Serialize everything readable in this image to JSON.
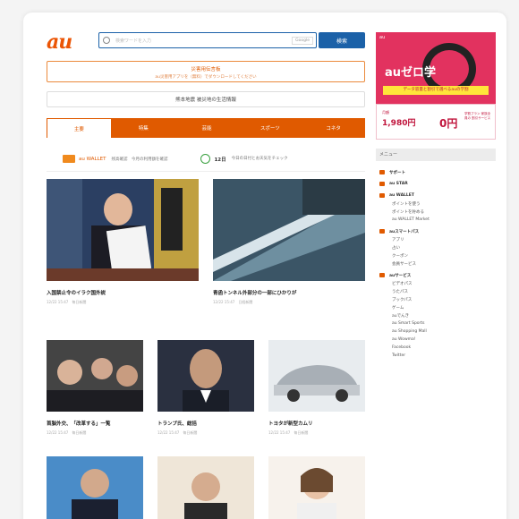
{
  "header": {
    "logo": "au",
    "search_placeholder": "検索ワードを入力",
    "search_engine": "Google",
    "search_button": "検索"
  },
  "notice": {
    "quake_title": "災害用伝言板",
    "quake_sub": "au災害用アプリを（無料）でダウンロードしてください",
    "kumamoto": "熊本地震 被災地の生活情報"
  },
  "tabs": [
    {
      "label": "主要"
    },
    {
      "label": "特集"
    },
    {
      "label": "芸能"
    },
    {
      "label": "スポーツ"
    },
    {
      "label": "コネタ"
    }
  ],
  "info": {
    "wallet_name": "au WALLET",
    "wallet_text": "残高確認　今月の利用額を確認",
    "date": "12日",
    "date_text": "今日の日付とお天気をチェック"
  },
  "news": {
    "big": [
      {
        "caption": "入国禁止令のイラク国外説　",
        "meta": "12/22 15:47　毎日新聞",
        "colors": [
          "#2b3f62",
          "#c0a040",
          "#e8e8e8",
          "#223"
        ]
      },
      {
        "caption": "青函トンネル外部分の一部にひかりが",
        "meta": "12/22 15:47　日経新聞",
        "colors": [
          "#3b5566",
          "#6e8fa0",
          "#d8e4ea",
          "#2b3b45"
        ]
      }
    ],
    "small": [
      {
        "caption": "首脳外交、「改革する」一覧",
        "meta": "12/22 15:47　毎日新聞",
        "colors": [
          "#2a2a2a",
          "#888",
          "#ddd"
        ]
      },
      {
        "caption": "トランプ氏、総括",
        "meta": "12/22 15:47　毎日新聞",
        "colors": [
          "#2a3040",
          "#c49a7c",
          "#fff"
        ]
      },
      {
        "caption": "トヨタが新型カムリ",
        "meta": "12/22 15:47　毎日新聞",
        "colors": [
          "#d8dde2",
          "#a8afb6",
          "#fff"
        ]
      }
    ]
  },
  "ad": {
    "corner": "au",
    "title": "auゼロ学",
    "band": "データ容量と割引で選べるauの学割",
    "bottom_label": "月額",
    "price": "1,980円",
    "zero": "0円",
    "note": "学割プラン 家族全員の 割引サービス"
  },
  "menu": {
    "heading": "メニュー",
    "items": [
      {
        "label": "サポート",
        "type": "head"
      },
      {
        "label": "au STAR",
        "type": "head"
      },
      {
        "label": "au WALLET",
        "type": "head"
      },
      {
        "label": "ポイントを使う",
        "type": "sub"
      },
      {
        "label": "ポイントを貯める",
        "type": "sub"
      },
      {
        "label": "au WALLET Market",
        "type": "sub"
      },
      {
        "label": "auスマートパス",
        "type": "head"
      },
      {
        "label": "アプリ",
        "type": "sub"
      },
      {
        "label": "占い",
        "type": "sub"
      },
      {
        "label": "クーポン",
        "type": "sub"
      },
      {
        "label": "会員サービス",
        "type": "sub"
      },
      {
        "label": "auサービス",
        "type": "head"
      },
      {
        "label": "ビデオパス",
        "type": "sub"
      },
      {
        "label": "うたパス",
        "type": "sub"
      },
      {
        "label": "ブックパス",
        "type": "sub"
      },
      {
        "label": "ゲーム",
        "type": "sub"
      },
      {
        "label": "auでんき",
        "type": "sub"
      },
      {
        "label": "au Smart Sports",
        "type": "sub"
      },
      {
        "label": "au Shopping Mall",
        "type": "sub"
      },
      {
        "label": "au Wowma!",
        "type": "sub"
      },
      {
        "label": "Facebook",
        "type": "sub"
      },
      {
        "label": "Twitter",
        "type": "sub"
      }
    ]
  }
}
